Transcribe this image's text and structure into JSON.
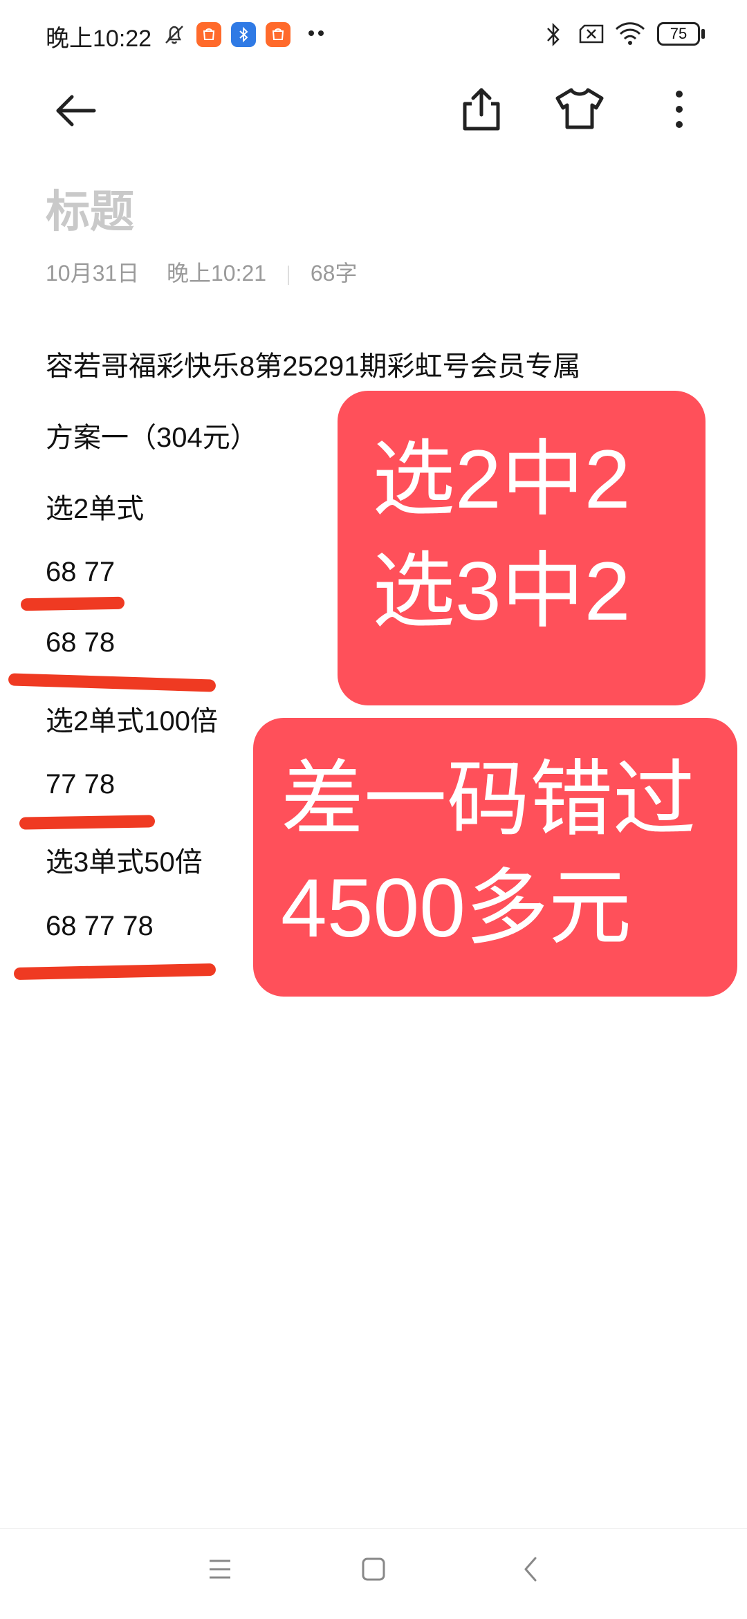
{
  "status_bar": {
    "time": "晚上10:22",
    "battery": "75",
    "icons": [
      "notifications-off-icon",
      "app-store-icon",
      "bluetooth-app-icon",
      "app-store-icon",
      "more-notifications-icon",
      "bluetooth-icon",
      "no-sim-icon",
      "wifi-icon",
      "battery-icon"
    ]
  },
  "toolbar": {
    "back_icon": "back-arrow-icon",
    "share_icon": "share-icon",
    "theme_icon": "tshirt-icon",
    "more_icon": "more-vert-icon"
  },
  "note": {
    "title": "标题",
    "date": "10月31日",
    "time": "晚上10:21",
    "char_count": "68字",
    "lines": [
      "容若哥福彩快乐8第25291期彩虹号会员专属",
      "方案一（304元）",
      "选2单式",
      "68 77",
      "68 78",
      "选2单式100倍",
      "77 78",
      "选3单式50倍",
      "68 77 78"
    ]
  },
  "overlay": {
    "card1": {
      "line1": "选2中2",
      "line2": "选3中2"
    },
    "card2": {
      "line1": "差一码错过",
      "line2": "4500多元"
    }
  },
  "nav_bar": {
    "icons": [
      "menu-icon",
      "home-icon",
      "back-icon"
    ]
  },
  "colors": {
    "card": "#ff505a",
    "stroke": "#ef3a22",
    "title_placeholder": "#c9c9c9"
  }
}
